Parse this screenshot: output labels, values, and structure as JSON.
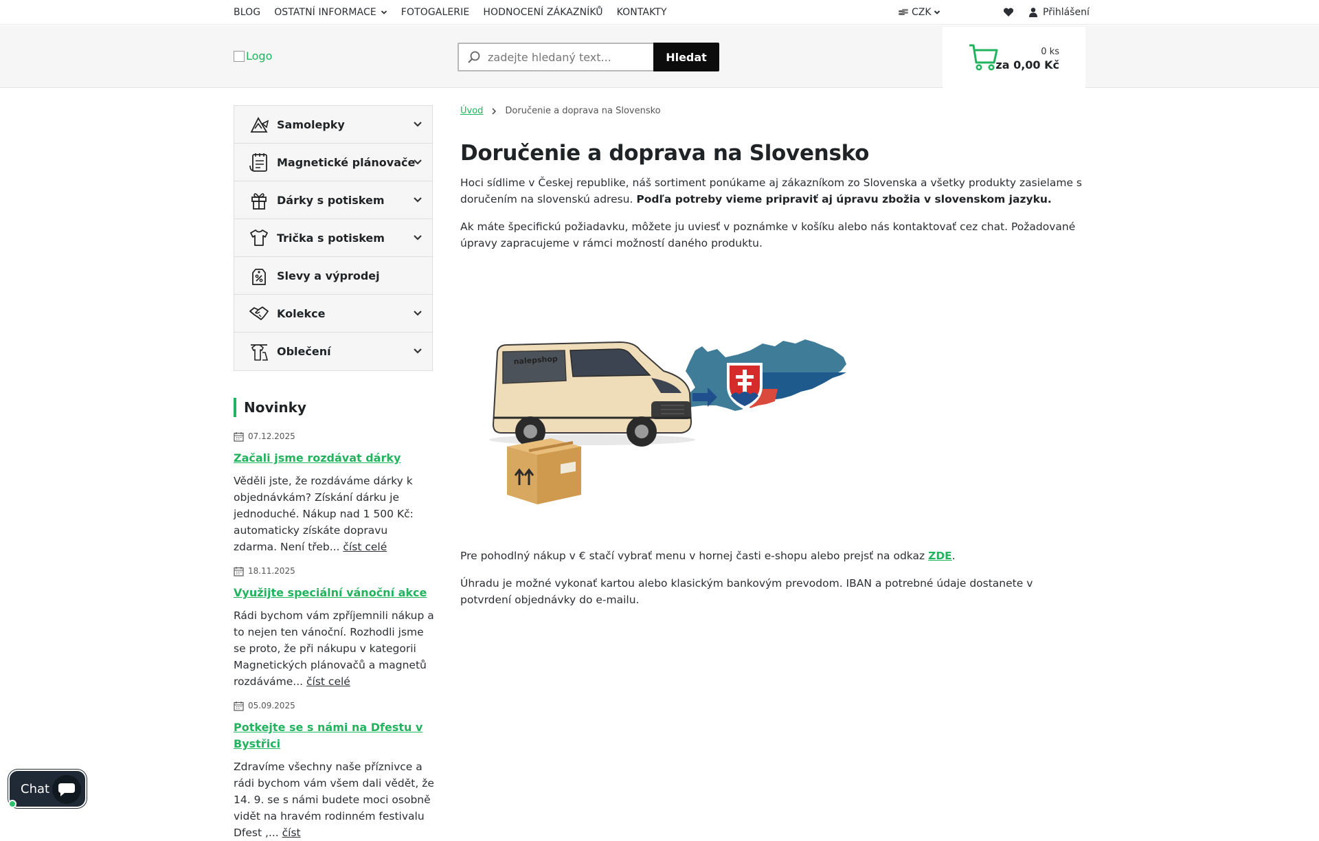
{
  "topnav": {
    "items": [
      {
        "label": "BLOG"
      },
      {
        "label": "OSTATNÍ INFORMACE",
        "dropdown": true
      },
      {
        "label": "FOTOGALERIE"
      },
      {
        "label": "HODNOCENÍ ZÁKAZNÍKŮ"
      },
      {
        "label": "KONTAKTY"
      }
    ],
    "currency": "CZK",
    "login_label": "Přihlášení"
  },
  "header": {
    "logo_alt": "Logo",
    "search": {
      "placeholder": "zadejte hledaný text...",
      "button_label": "Hledat"
    },
    "cart": {
      "quantity": "0 ks",
      "total": "za 0,00 Kč"
    }
  },
  "sidebar": {
    "categories": [
      {
        "label": "Samolepky",
        "icon": "sticker-icon",
        "expandable": true
      },
      {
        "label": "Magnetické plánovače",
        "icon": "planner-icon",
        "expandable": true
      },
      {
        "label": "Dárky s potiskem",
        "icon": "gift-icon",
        "expandable": true
      },
      {
        "label": "Trička s potiskem",
        "icon": "tshirt-icon",
        "expandable": true
      },
      {
        "label": "Slevy a výprodej",
        "icon": "discount-tag-icon",
        "expandable": false
      },
      {
        "label": "Kolekce",
        "icon": "handshake-icon",
        "expandable": true
      },
      {
        "label": "Oblečení",
        "icon": "clothing-icon",
        "expandable": true
      }
    ],
    "news_heading": "Novinky",
    "news": [
      {
        "date": "07.12.2025",
        "title": " Začali jsme rozdávat dárky",
        "text": "Věděli jste, že rozdáváme dárky k objednávkám?   Získání dárku je jednoduché. Nákup nad 1 500 Kč: automaticky získáte dopravu zdarma. Není třeb...",
        "more": "číst celé"
      },
      {
        "date": "18.11.2025",
        "title": " Využijte speciální vánoční akce",
        "text": "Rádi bychom vám zpříjemnili nákup a to nejen ten vánoční. Rozhodli jsme se proto, že při nákupu v kategorii Magnetických plánovačů a magnetů rozdáváme...",
        "more": "číst celé"
      },
      {
        "date": "05.09.2025",
        "title": "Potkejte se s námi na Dfestu v Bystřici",
        "text": " Zdravíme všechny naše příznivce a rádi bychom vám všem dali vědět, že 14. 9. se s námi budete moci osobně vidět na hravém rodinném festivalu Dfest ,...",
        "more": "číst"
      }
    ]
  },
  "breadcrumb": {
    "home": "Úvod",
    "current": "Doručenie a doprava na Slovensko"
  },
  "content": {
    "title": "Doručenie a doprava na Slovensko",
    "p1_normal": "Hoci sídlime v Českej republike, náš sortiment ponúkame aj zákazníkom zo Slovenska a všetky produkty zasielame s doručením na slovenskú adresu. ",
    "p1_bold": "Podľa potreby vieme pripraviť aj úpravu zbožia v slovenskom jazyku.",
    "p2": "Ak máte špecifickú požiadavku, môžete ju uviesť v poznámke v košíku alebo nás kontaktovať cez chat. Požadované úpravy zapracujeme v rámci možností daného produktu.",
    "van_label": "nalepshop",
    "p3_before": "Pre pohodlný nákup v € stačí vybrať menu v hornej časti e-shopu alebo prejsť na odkaz ",
    "p3_link": "ZDE",
    "p3_after": ".",
    "p4": "Úhradu je možné vykonať kartou alebo klasickým bankovým prevodom. IBAN a potrebné údaje dostanete v potvrdení objednávky do e-mailu."
  },
  "chat": {
    "label": "Chat"
  },
  "colors": {
    "accent": "#22b35e",
    "dark": "#0c0c0c",
    "chat_bg": "#1f2a36"
  }
}
